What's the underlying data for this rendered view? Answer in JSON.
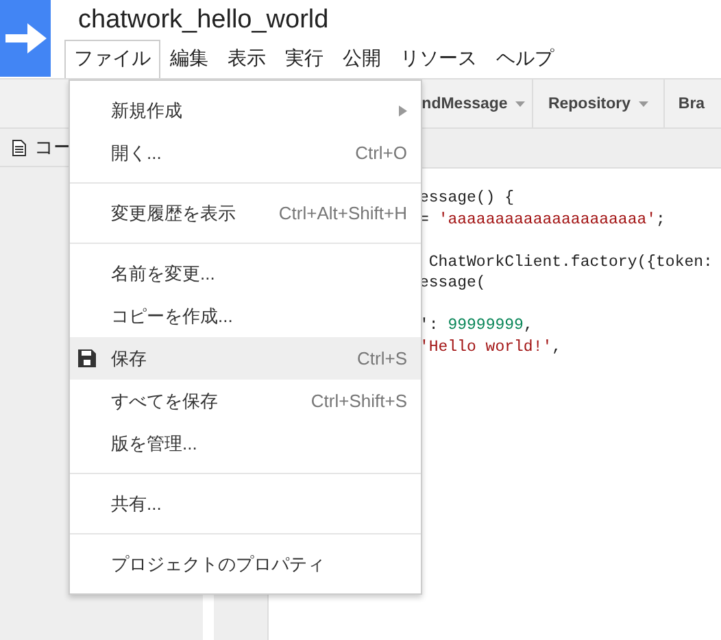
{
  "header": {
    "title": "chatwork_hello_world"
  },
  "menu_bar": [
    {
      "label": "ファイル",
      "selected": true
    },
    {
      "label": "編集",
      "selected": false
    },
    {
      "label": "表示",
      "selected": false
    },
    {
      "label": "実行",
      "selected": false
    },
    {
      "label": "公開",
      "selected": false
    },
    {
      "label": "リソース",
      "selected": false
    },
    {
      "label": "ヘルプ",
      "selected": false
    }
  ],
  "toolbar": [
    {
      "label": "ndMessage",
      "kind": "dropdown"
    },
    {
      "label": "Repository",
      "kind": "dropdown"
    },
    {
      "label": "Bra",
      "kind": "plain"
    }
  ],
  "file_tab": {
    "label": "コー"
  },
  "code_lines": [
    {
      "spaced": false,
      "segments": [
        {
          "text": "essage() {",
          "kind": "plain"
        }
      ]
    },
    {
      "spaced": false,
      "segments": [
        {
          "text": "= ",
          "kind": "plain"
        },
        {
          "text": "'aaaaaaaaaaaaaaaaaaaaa'",
          "kind": "string"
        },
        {
          "text": ";",
          "kind": "plain"
        }
      ]
    },
    {
      "spaced": true,
      "segments": [
        {
          "text": " ChatWorkClient.factory({token:",
          "kind": "plain"
        }
      ]
    },
    {
      "spaced": false,
      "segments": [
        {
          "text": "essage(",
          "kind": "plain"
        }
      ]
    },
    {
      "spaced": true,
      "segments": [
        {
          "text": "': ",
          "kind": "plain"
        },
        {
          "text": "99999999",
          "kind": "number"
        },
        {
          "text": ",",
          "kind": "plain"
        }
      ]
    },
    {
      "spaced": false,
      "segments": [
        {
          "text": "'Hello world!'",
          "kind": "string"
        },
        {
          "text": ",",
          "kind": "plain"
        }
      ]
    }
  ],
  "file_menu": [
    [
      {
        "label": "新規作成",
        "kind": "submenu",
        "selected": false
      },
      {
        "label": "開く...",
        "shortcut": "Ctrl+O",
        "kind": "plain",
        "selected": false
      }
    ],
    [
      {
        "label": "変更履歴を表示",
        "shortcut": "Ctrl+Alt+Shift+H",
        "kind": "plain",
        "selected": false
      }
    ],
    [
      {
        "label": "名前を変更...",
        "kind": "plain",
        "selected": false
      },
      {
        "label": "コピーを作成...",
        "kind": "plain",
        "selected": false
      },
      {
        "label": "保存",
        "shortcut": "Ctrl+S",
        "kind": "save",
        "selected": true
      },
      {
        "label": "すべてを保存",
        "shortcut": "Ctrl+Shift+S",
        "kind": "plain",
        "selected": false
      },
      {
        "label": "版を管理...",
        "kind": "plain",
        "selected": false
      }
    ],
    [
      {
        "label": "共有...",
        "kind": "plain",
        "selected": false
      }
    ],
    [
      {
        "label": "プロジェクトのプロパティ",
        "kind": "plain",
        "selected": false
      }
    ]
  ]
}
